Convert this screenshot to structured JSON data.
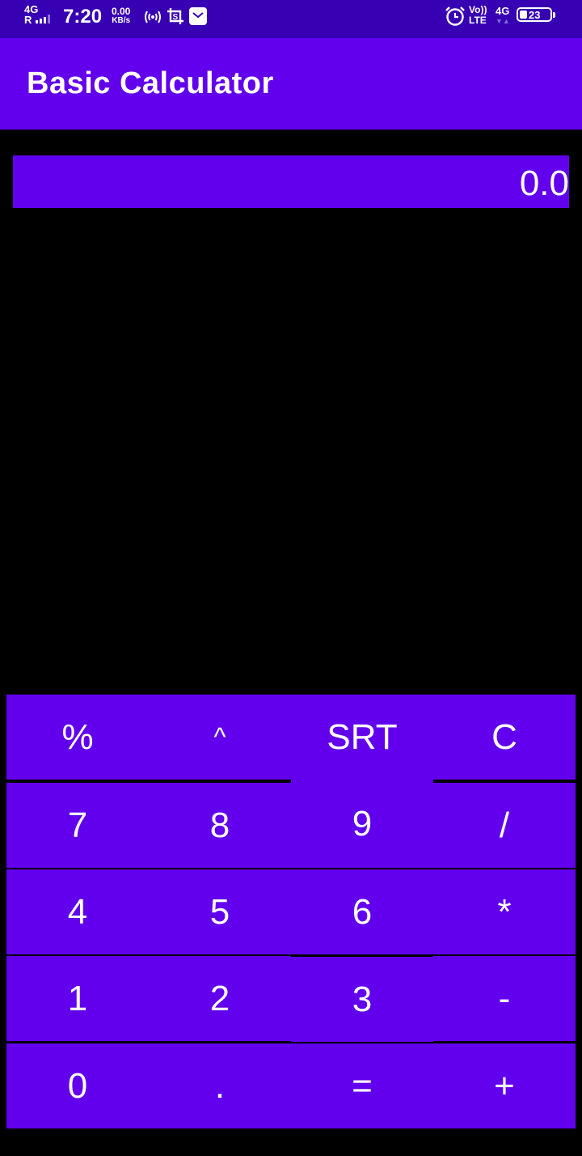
{
  "status_bar": {
    "network_left": "4G",
    "roaming": "R",
    "time": "7:20",
    "speed_value": "0.00",
    "speed_unit": "KB/s",
    "volte_top": "Vo))",
    "volte_bottom": "LTE",
    "network_right": "4G",
    "battery_level": "23",
    "icons": [
      "hotspot-icon",
      "screenshot-icon",
      "mail-icon",
      "alarm-icon",
      "battery-icon"
    ]
  },
  "app_bar": {
    "title": "Basic Calculator"
  },
  "display": {
    "value": "0.0"
  },
  "keypad": {
    "rows": [
      [
        "%",
        "^",
        "SRT",
        "C"
      ],
      [
        "7",
        "8",
        "9",
        "/"
      ],
      [
        "4",
        "5",
        "6",
        "*"
      ],
      [
        "1",
        "2",
        "3",
        "-"
      ],
      [
        "0",
        ".",
        "=",
        "+"
      ]
    ]
  },
  "colors": {
    "status_bar": "#3700b3",
    "primary": "#6200ee",
    "background": "#000000",
    "text": "#ffffff"
  }
}
